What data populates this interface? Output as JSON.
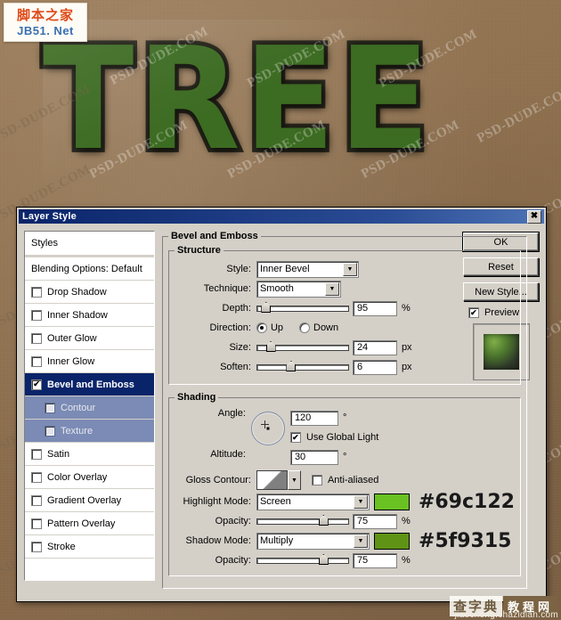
{
  "artwork": {
    "headline_text": "TREE",
    "backdrop_color": "#8d7050",
    "text_green": "#3c6b22",
    "text_edge": "#2b2a20"
  },
  "branding": {
    "jb51": {
      "cn": "脚本之家",
      "en": "JB51. Net"
    },
    "chazidian": {
      "cn": "查字典",
      "tag": "教程网",
      "url": "jiaocheng.chazidian.com"
    }
  },
  "watermarks": [
    "PSD-DUDE.COM",
    "PSD-DUDE.COM",
    "PSD-DUDE.COM",
    "PSD-DUDE.COM",
    "PSD-DUDE.COM",
    "PSD-DUDE.COM",
    "PSD-DUDE.COM",
    "PSD-DUDE.COM",
    "PSD-DUDE.COM",
    "PSD-DUDE.COM",
    "PSD-DUDE.COM",
    "PSD-DUDE.COM",
    "PSD-DUDE.COM",
    "PSD-DUDE.COM",
    "PSD-DUDE.COM",
    "PSD-DUDE.COM"
  ],
  "dialog": {
    "title": "Layer Style",
    "close_icon": "close-icon",
    "styles_panel": {
      "header": "Styles",
      "blending_options": "Blending Options: Default",
      "effects": [
        {
          "label": "Drop Shadow",
          "checked": false,
          "selected": false,
          "sub": false
        },
        {
          "label": "Inner Shadow",
          "checked": false,
          "selected": false,
          "sub": false
        },
        {
          "label": "Outer Glow",
          "checked": false,
          "selected": false,
          "sub": false
        },
        {
          "label": "Inner Glow",
          "checked": false,
          "selected": false,
          "sub": false
        },
        {
          "label": "Bevel and Emboss",
          "checked": true,
          "selected": true,
          "sub": false
        },
        {
          "label": "Contour",
          "checked": false,
          "selected": false,
          "sub": true
        },
        {
          "label": "Texture",
          "checked": false,
          "selected": false,
          "sub": true
        },
        {
          "label": "Satin",
          "checked": false,
          "selected": false,
          "sub": false
        },
        {
          "label": "Color Overlay",
          "checked": false,
          "selected": false,
          "sub": false
        },
        {
          "label": "Gradient Overlay",
          "checked": false,
          "selected": false,
          "sub": false
        },
        {
          "label": "Pattern Overlay",
          "checked": false,
          "selected": false,
          "sub": false
        },
        {
          "label": "Stroke",
          "checked": false,
          "selected": false,
          "sub": false
        }
      ],
      "check_glyph": "✔"
    },
    "bevel_group_title": "Bevel and Emboss",
    "structure": {
      "title": "Structure",
      "style_label": "Style:",
      "style_value": "Inner Bevel",
      "technique_label": "Technique:",
      "technique_value": "Smooth",
      "depth_label": "Depth:",
      "depth_value": "95",
      "depth_unit": "%",
      "depth_pct": 10,
      "direction_label": "Direction:",
      "direction_up": "Up",
      "direction_down": "Down",
      "direction_selected": "Up",
      "size_label": "Size:",
      "size_value": "24",
      "size_unit": "px",
      "size_pct": 15,
      "soften_label": "Soften:",
      "soften_value": "6",
      "soften_unit": "px",
      "soften_pct": 37
    },
    "shading": {
      "title": "Shading",
      "angle_label": "Angle:",
      "angle_value": "120",
      "angle_unit": "°",
      "use_global_light_label": "Use Global Light",
      "use_global_light_checked": true,
      "altitude_label": "Altitude:",
      "altitude_value": "30",
      "altitude_unit": "°",
      "gloss_contour_label": "Gloss Contour:",
      "anti_aliased_label": "Anti-aliased",
      "anti_aliased_checked": false,
      "highlight_mode_label": "Highlight Mode:",
      "highlight_mode_value": "Screen",
      "highlight_color": "#69c122",
      "highlight_hex_text": "#69c122",
      "highlight_opacity_label": "Opacity:",
      "highlight_opacity_value": "75",
      "highlight_opacity_unit": "%",
      "highlight_opacity_pct": 72,
      "shadow_mode_label": "Shadow Mode:",
      "shadow_mode_value": "Multiply",
      "shadow_color": "#5f9315",
      "shadow_hex_text": "#5f9315",
      "shadow_opacity_label": "Opacity:",
      "shadow_opacity_value": "75",
      "shadow_opacity_unit": "%",
      "shadow_opacity_pct": 72
    },
    "buttons": {
      "ok": "OK",
      "reset": "Reset",
      "new_style": "New Style...",
      "preview_label": "Preview",
      "preview_checked": true
    }
  }
}
